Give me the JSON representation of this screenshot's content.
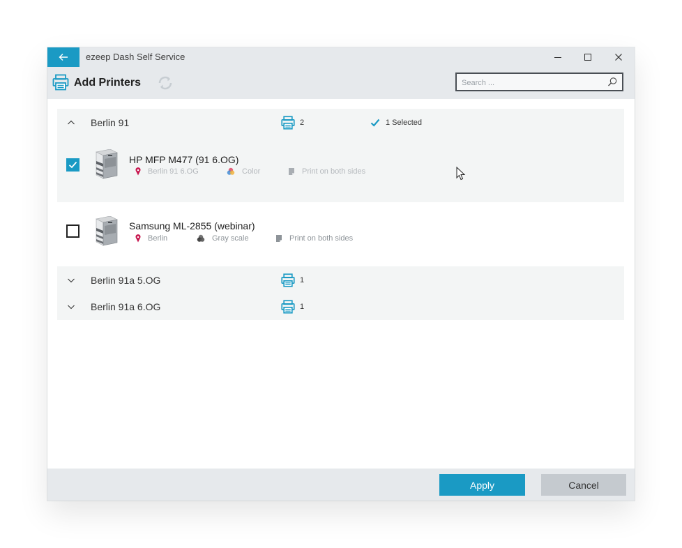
{
  "app": {
    "title": "ezeep Dash Self Service"
  },
  "toolbar": {
    "title": "Add Printers",
    "search_placeholder": "Search ..."
  },
  "groups": [
    {
      "name": "Berlin 91",
      "count": "2",
      "selected_text": "1 Selected",
      "expanded": true,
      "printers": [
        {
          "name": "HP MFP M477 (91 6.OG)",
          "checked": true,
          "location": "Berlin 91 6.OG",
          "color_mode": "Color",
          "duplex": "Print on both sides"
        },
        {
          "name": "Samsung ML-2855 (webinar)",
          "checked": false,
          "location": "Berlin",
          "color_mode": "Gray scale",
          "duplex": "Print on both sides"
        }
      ]
    },
    {
      "name": "Berlin 91a 5.OG",
      "count": "1",
      "expanded": false
    },
    {
      "name": "Berlin 91a 6.OG",
      "count": "1",
      "expanded": false
    }
  ],
  "footer": {
    "apply_label": "Apply",
    "cancel_label": "Cancel"
  },
  "colors": {
    "accent": "#1a9ac4",
    "location_pin": "#c8174f",
    "chrome": "#e6e9ec"
  },
  "icons": [
    "back-arrow-icon",
    "minimize-icon",
    "maximize-icon",
    "close-icon",
    "printer-icon",
    "refresh-icon",
    "search-icon",
    "chevron-up-icon",
    "chevron-down-icon",
    "checkmark-icon",
    "location-pin-icon",
    "color-icon",
    "grayscale-icon",
    "duplex-icon",
    "cursor-icon"
  ]
}
